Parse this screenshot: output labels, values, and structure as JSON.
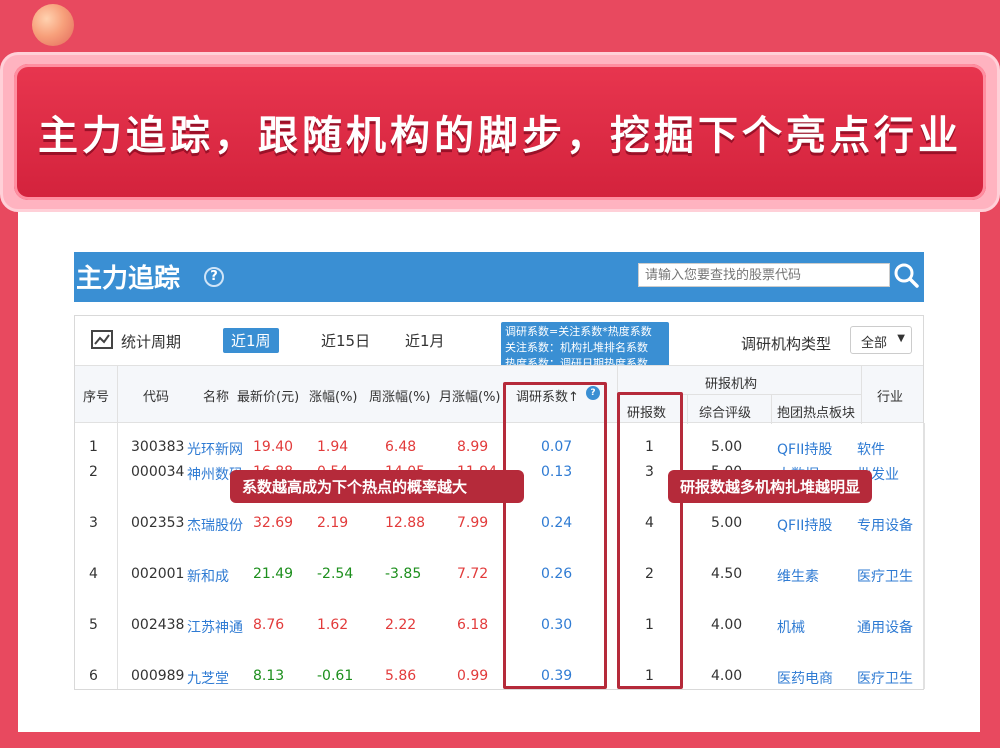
{
  "banner": {
    "headline": "主力追踪，跟随机构的脚步，挖掘下个亮点行业"
  },
  "panel": {
    "title": "主力追踪",
    "help_glyph": "?",
    "search": {
      "placeholder": "请输入您要查找的股票代码"
    },
    "period_label": "统计周期",
    "periods": [
      "近1周",
      "近15日",
      "近1月"
    ],
    "active_period": "近1周",
    "institution_type_label": "调研机构类型",
    "institution_type_value": "全部",
    "tooltip_lines": [
      "调研系数=关注系数*热度系数",
      "关注系数：机构扎堆排名系数",
      "热度系数：调研日期热度系数"
    ]
  },
  "table": {
    "headers": {
      "index": "序号",
      "code": "代码",
      "name": "名称",
      "price": "最新价(元)",
      "change": "涨幅(%)",
      "week_change": "周涨幅(%)",
      "month_change": "月涨幅(%)",
      "research_coef": "调研系数↑",
      "group": "研报机构",
      "report_count": "研报数",
      "rating": "综合评级",
      "hot_sector": "抱团热点板块",
      "industry": "行业"
    },
    "rows": [
      {
        "index": "1",
        "code": "300383",
        "name": "光环新网",
        "price": "19.40",
        "change": "1.94",
        "week": "6.48",
        "month": "8.99",
        "coef": "0.07",
        "reports": "1",
        "rating": "5.00",
        "sector": "QFII持股",
        "industry": "软件",
        "price_color": "red",
        "change_color": "red",
        "week_color": "red",
        "month_color": "red"
      },
      {
        "index": "2",
        "code": "000034",
        "name": "神州数码",
        "price": "16.88",
        "change": "0.54",
        "week": "14.05",
        "month": "11.94",
        "coef": "0.13",
        "reports": "3",
        "rating": "5.00",
        "sector": "大数据",
        "industry": "批发业",
        "price_color": "red",
        "change_color": "red",
        "week_color": "red",
        "month_color": "red"
      },
      {
        "index": "3",
        "code": "002353",
        "name": "杰瑞股份",
        "price": "32.69",
        "change": "2.19",
        "week": "12.88",
        "month": "7.99",
        "coef": "0.24",
        "reports": "4",
        "rating": "5.00",
        "sector": "QFII持股",
        "industry": "专用设备",
        "price_color": "red",
        "change_color": "red",
        "week_color": "red",
        "month_color": "red"
      },
      {
        "index": "4",
        "code": "002001",
        "name": "新和成",
        "price": "21.49",
        "change": "-2.54",
        "week": "-3.85",
        "month": "7.72",
        "coef": "0.26",
        "reports": "2",
        "rating": "4.50",
        "sector": "维生素",
        "industry": "医疗卫生",
        "price_color": "green",
        "change_color": "green",
        "week_color": "green",
        "month_color": "red"
      },
      {
        "index": "5",
        "code": "002438",
        "name": "江苏神通",
        "price": "8.76",
        "change": "1.62",
        "week": "2.22",
        "month": "6.18",
        "coef": "0.30",
        "reports": "1",
        "rating": "4.00",
        "sector": "机械",
        "industry": "通用设备",
        "price_color": "red",
        "change_color": "red",
        "week_color": "red",
        "month_color": "red"
      },
      {
        "index": "6",
        "code": "000989",
        "name": "九芝堂",
        "price": "8.13",
        "change": "-0.61",
        "week": "5.86",
        "month": "0.99",
        "coef": "0.39",
        "reports": "1",
        "rating": "4.00",
        "sector": "医药电商",
        "industry": "医疗卫生",
        "price_color": "green",
        "change_color": "green",
        "week_color": "red",
        "month_color": "red"
      }
    ]
  },
  "callouts": {
    "left": "系数越高成为下个热点的概率越大",
    "right": "研报数越多机构扎堆越明显"
  },
  "colors": {
    "background": "#e8495f",
    "banner": "#d3223c",
    "header_blue": "#3a8fd3",
    "highlight": "#b52a3a",
    "up": "#e23b3b",
    "down": "#1d8f1d",
    "link": "#2f7bd3"
  }
}
